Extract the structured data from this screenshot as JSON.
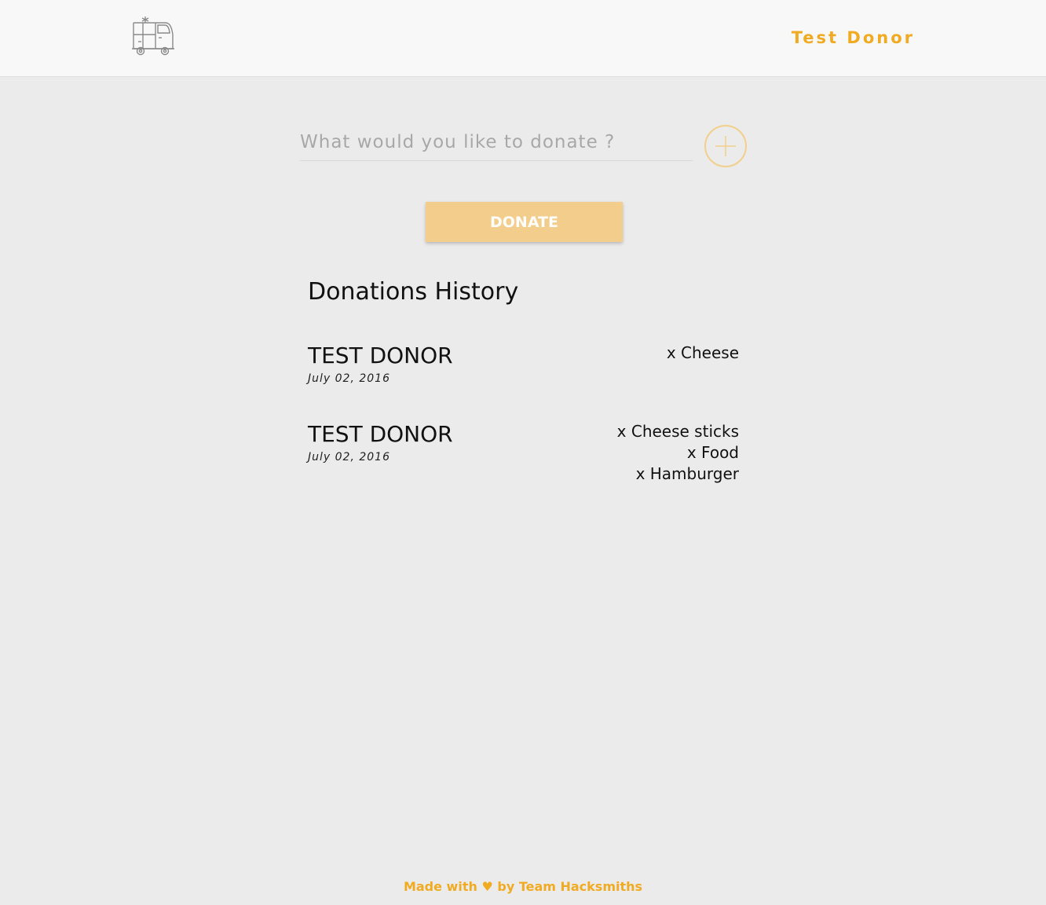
{
  "header": {
    "logo_icon": "food-truck-icon",
    "user_name": "Test Donor"
  },
  "donate_form": {
    "placeholder": "What would you like to donate ?",
    "add_icon": "plus-icon",
    "donate_label": "DONATE"
  },
  "history": {
    "title": "Donations History",
    "donations": [
      {
        "donor": "TEST DONOR",
        "date": "July 02, 2016",
        "items": [
          "x Cheese"
        ]
      },
      {
        "donor": "TEST DONOR",
        "date": "July 02, 2016",
        "items": [
          "x Cheese sticks",
          "x Food",
          "x Hamburger"
        ]
      }
    ]
  },
  "footer": {
    "prefix": "Made with",
    "heart": "♥",
    "suffix": "by Team Hacksmiths"
  },
  "colors": {
    "accent": "#f1ab23",
    "button": "#f3cd8b",
    "background": "#ebebeb",
    "header_bg": "#f8f8f8"
  }
}
